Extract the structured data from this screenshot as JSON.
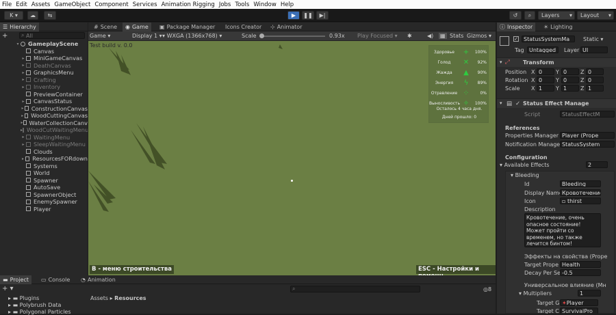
{
  "menu": [
    "File",
    "Edit",
    "Assets",
    "GameObject",
    "Component",
    "Services",
    "Animation Rigging",
    "Jobs",
    "Tools",
    "Window",
    "Help"
  ],
  "toolbar": {
    "account": "K",
    "layers": "Layers",
    "layout": "Layout"
  },
  "hierarchy": {
    "tab": "Hierarchy",
    "search": "All",
    "items": [
      {
        "label": "GameplayScene",
        "indent": 0,
        "dim": false,
        "scene": true
      },
      {
        "label": "Canvas",
        "indent": 1,
        "dim": false
      },
      {
        "label": "MiniGameCanvas",
        "indent": 1,
        "dim": false
      },
      {
        "label": "DeathCanvas",
        "indent": 1,
        "dim": true
      },
      {
        "label": "GraphicsMenu",
        "indent": 1,
        "dim": false
      },
      {
        "label": "Crafting",
        "indent": 1,
        "dim": true
      },
      {
        "label": "Inventory",
        "indent": 1,
        "dim": true
      },
      {
        "label": "PreviewContainer",
        "indent": 1,
        "dim": false
      },
      {
        "label": "CanvasStatus",
        "indent": 1,
        "dim": false
      },
      {
        "label": "ConstructionCanvas",
        "indent": 1,
        "dim": false
      },
      {
        "label": "WoodCuttingCanvas",
        "indent": 1,
        "dim": false
      },
      {
        "label": "WaterCollectionCanv",
        "indent": 1,
        "dim": false
      },
      {
        "label": "WoodCutWaitingMenu",
        "indent": 1,
        "dim": true
      },
      {
        "label": "WaitingMenu",
        "indent": 1,
        "dim": true
      },
      {
        "label": "SleepWaitingMenu",
        "indent": 1,
        "dim": true
      },
      {
        "label": "Clouds",
        "indent": 1,
        "dim": false
      },
      {
        "label": "ResourcesFORdown",
        "indent": 1,
        "dim": false
      },
      {
        "label": "Systems",
        "indent": 1,
        "dim": false
      },
      {
        "label": "World",
        "indent": 1,
        "dim": false
      },
      {
        "label": "Spawner",
        "indent": 1,
        "dim": false
      },
      {
        "label": "AutoSave",
        "indent": 1,
        "dim": false
      },
      {
        "label": "SpawnerObject",
        "indent": 1,
        "dim": false
      },
      {
        "label": "EnemySpawner",
        "indent": 1,
        "dim": false
      },
      {
        "label": "Player",
        "indent": 1,
        "dim": false
      }
    ]
  },
  "game": {
    "tabs": [
      "Scene",
      "Game",
      "Package Manager",
      "Icons Creator",
      "Animator"
    ],
    "mode": "Game",
    "display": "Display 1",
    "resolution": "WXGA (1366x768)",
    "scale_label": "Scale",
    "scale_value": "0.93x",
    "play_focused": "Play Focused",
    "stats": "Stats",
    "gizmos": "Gizmos",
    "build_text": "Test build v. 0.0",
    "hud": [
      {
        "label": "Здоровье",
        "icon": "+",
        "value": "100%"
      },
      {
        "label": "Голод",
        "icon": "✕",
        "value": "92%"
      },
      {
        "label": "Жажда",
        "icon": "▲",
        "value": "90%"
      },
      {
        "label": "Энергия",
        "icon": "ϟ",
        "value": "89%"
      },
      {
        "label": "Отравление",
        "icon": "⁘",
        "value": "0%"
      },
      {
        "label": "Выносливость",
        "icon": "✧",
        "value": "100%"
      }
    ],
    "days_left": "Осталось 4 часа дня.",
    "days_passed": "Дней прошло: 0",
    "hint_left": "B - меню строительства",
    "hint_right": "ESC - Настройки и помощь"
  },
  "inspector": {
    "tabs": [
      "Inspector",
      "Lighting"
    ],
    "object_name": "StatusSystemMa",
    "static": "Static",
    "tag_label": "Tag",
    "tag": "Untagged",
    "layer_label": "Layer",
    "layer": "UI",
    "transform": "Transform",
    "pos_label": "Position",
    "rot_label": "Rotation",
    "scale_label": "Scale",
    "pos": [
      "0",
      "0",
      "0"
    ],
    "rot": [
      "0",
      "0",
      "0"
    ],
    "scl": [
      "1",
      "1",
      "1"
    ],
    "component": "Status Effect Manage",
    "script_label": "Script",
    "script": "StatusEffectM",
    "references": "References",
    "props_label": "Properties Manager",
    "props_value": "Player (Prope",
    "notif_label": "Notification Manager",
    "notif_value": "StatusSystem",
    "config": "Configuration",
    "available_label": "Available Effects",
    "available": "2",
    "bleeding": "Bleeding",
    "id_label": "Id",
    "id": "Bleeding",
    "display_label": "Display Name",
    "display": "Кровотечение",
    "icon_label": "Icon",
    "icon": "thirst",
    "desc_label": "Description",
    "desc": "Кровотечение, очень опасное состояние! Может пройти со временем, но также лечится бинтом!",
    "effects_label": "Эффекты на свойства (Prope",
    "target_label": "Target Prope",
    "target": "Health",
    "decay_label": "Decay Per Se",
    "decay": "-0.5",
    "universal": "Универсальное влияние (Mн",
    "multipliers": "Multipliers",
    "mult_count": "1",
    "target_g": "Target G",
    "target_g_val": "Player",
    "target_c": "Target C",
    "target_c_val": "SurvivalPro"
  },
  "bottom": {
    "tabs": [
      "Project",
      "Console",
      "Animation"
    ],
    "breadcrumb_root": "Assets",
    "breadcrumb_current": "Resources",
    "folders": [
      "Plugins",
      "Polybrush Data",
      "Polygonal Particles"
    ],
    "count": "8"
  }
}
